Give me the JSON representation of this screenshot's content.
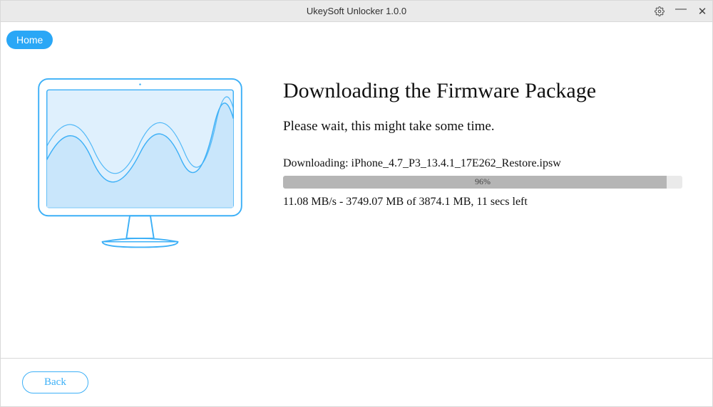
{
  "window": {
    "title": "UkeySoft Unlocker 1.0.0"
  },
  "nav": {
    "home_label": "Home"
  },
  "main": {
    "heading": "Downloading the Firmware Package",
    "subtext": "Please wait, this might take some time.",
    "download_prefix": "Downloading: ",
    "download_filename": "iPhone_4.7_P3_13.4.1_17E262_Restore.ipsw",
    "progress_percent": 96,
    "progress_label": "96%",
    "stats_line": "11.08 MB/s - 3749.07 MB of 3874.1 MB, 11 secs left"
  },
  "footer": {
    "back_label": "Back"
  },
  "colors": {
    "accent": "#2aa7f6",
    "illus_stroke": "#3db0f7",
    "illus_fill": "#dff0fd"
  }
}
